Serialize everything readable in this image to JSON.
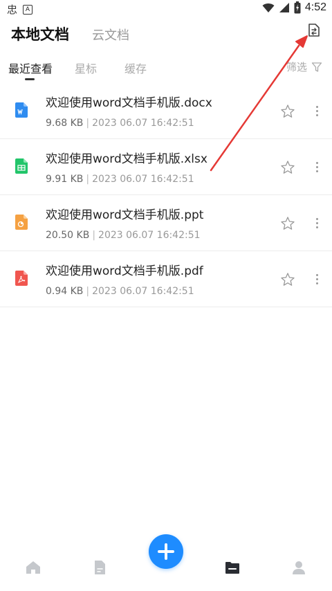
{
  "status_bar": {
    "time": "4:52",
    "left_glyph": "忠",
    "left_badge": "A"
  },
  "header": {
    "title_local": "本地文档",
    "title_cloud": "云文档",
    "action_icon": "file-transfer-icon"
  },
  "subtabs": [
    {
      "label": "最近查看",
      "active": true
    },
    {
      "label": "星标",
      "active": false
    },
    {
      "label": "缓存",
      "active": false
    }
  ],
  "filter": {
    "label": "筛选"
  },
  "files": [
    {
      "name": "欢迎使用word文档手机版.docx",
      "size": "9.68 KB",
      "date": "2023 06.07 16:42:51",
      "type": "doc",
      "color": "#2f8cf0"
    },
    {
      "name": "欢迎使用word文档手机版.xlsx",
      "size": "9.91 KB",
      "date": "2023 06.07 16:42:51",
      "type": "xls",
      "color": "#22c56a"
    },
    {
      "name": "欢迎使用word文档手机版.ppt",
      "size": "20.50 KB",
      "date": "2023 06.07 16:42:51",
      "type": "ppt",
      "color": "#f5a142"
    },
    {
      "name": "欢迎使用word文档手机版.pdf",
      "size": "0.94 KB",
      "date": "2023 06.07 16:42:51",
      "type": "pdf",
      "color": "#f0564f"
    }
  ],
  "colors": {
    "accent": "#1e8cff",
    "annotation_arrow": "#e53935"
  }
}
